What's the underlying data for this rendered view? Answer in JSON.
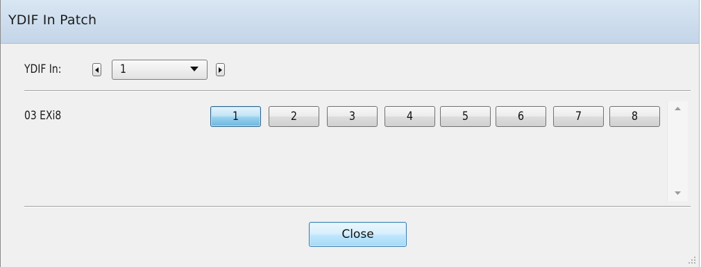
{
  "window": {
    "title": "YDIF In Patch"
  },
  "ydif_in": {
    "label": "YDIF In:",
    "selected": "1"
  },
  "patch_row": {
    "label": "03 EXi8",
    "buttons": [
      "1",
      "2",
      "3",
      "4",
      "5",
      "6",
      "7",
      "8"
    ],
    "active_index": 0
  },
  "footer": {
    "close_label": "Close"
  },
  "colors": {
    "titlebar": "#c3d5e8",
    "active_button": "#98d1ef",
    "background": "#f0f0f0"
  },
  "icons": [
    "arrow-left-icon",
    "arrow-right-icon",
    "dropdown-caret-icon",
    "scroll-up-icon",
    "scroll-down-icon",
    "resize-grip-icon"
  ]
}
